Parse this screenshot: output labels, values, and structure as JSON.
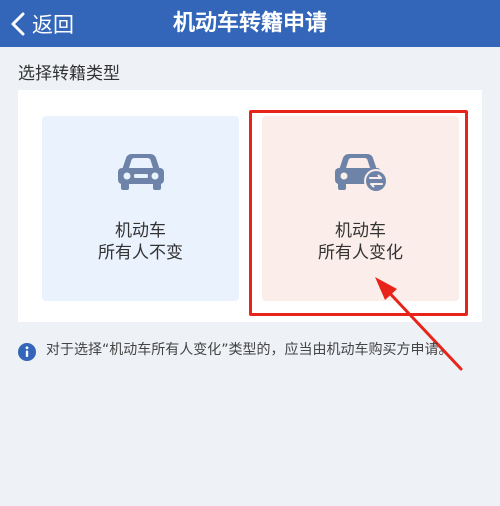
{
  "header": {
    "back_label": "返回",
    "title": "机动车转籍申请"
  },
  "section_title": "选择转籍类型",
  "options": [
    {
      "line1": "机动车",
      "line2": "所有人不变",
      "icon": "car-icon",
      "selected": false
    },
    {
      "line1": "机动车",
      "line2": "所有人变化",
      "icon": "car-transfer-icon",
      "selected": true
    }
  ],
  "notice": {
    "icon": "info-icon",
    "text": "对于选择“机动车所有人变化”类型的，应当由机动车购买方申请。"
  },
  "colors": {
    "header_bg": "#3366b8",
    "page_bg": "#eef1f6",
    "option_left_bg": "#eaf2fd",
    "option_right_bg": "#fbeeea",
    "car_icon": "#6d84a8",
    "highlight": "#e8241a",
    "info_icon": "#3366b8"
  }
}
